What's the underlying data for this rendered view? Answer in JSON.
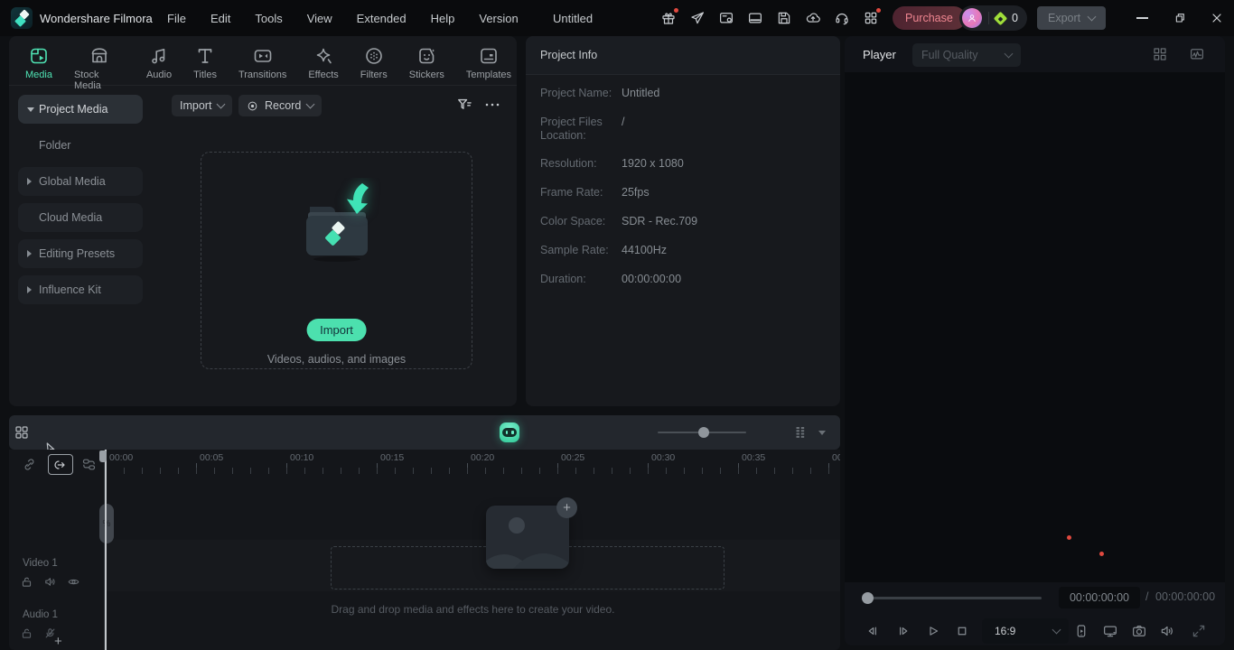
{
  "topbar": {
    "app_title": "Wondershare Filmora",
    "menus": [
      "File",
      "Edit",
      "Tools",
      "View",
      "Extended",
      "Help",
      "Version"
    ],
    "document_title": "Untitled",
    "purchase_label": "Purchase",
    "credit_count": "0",
    "export_label": "Export"
  },
  "media_panel": {
    "tabs": [
      "Media",
      "Stock Media",
      "Audio",
      "Titles",
      "Transitions",
      "Effects",
      "Filters",
      "Stickers",
      "Templates"
    ],
    "sidebar_items": [
      "Project Media",
      "Folder",
      "Global Media",
      "Cloud Media",
      "Editing Presets",
      "Influence Kit"
    ],
    "import_dropdown": "Import",
    "record_dropdown": "Record",
    "import_button": "Import",
    "import_hint": "Videos, audios, and images"
  },
  "project_info": {
    "title": "Project Info",
    "rows": [
      {
        "label": "Project Name:",
        "value": "Untitled"
      },
      {
        "label": "Project Files Location:",
        "value": "/"
      },
      {
        "label": "Resolution:",
        "value": "1920 x 1080"
      },
      {
        "label": "Frame Rate:",
        "value": "25fps"
      },
      {
        "label": "Color Space:",
        "value": "SDR - Rec.709"
      },
      {
        "label": "Sample Rate:",
        "value": "44100Hz"
      },
      {
        "label": "Duration:",
        "value": "00:00:00:00"
      }
    ]
  },
  "player": {
    "title": "Player",
    "quality": "Full Quality",
    "current_time": "00:00:00:00",
    "separator": "/",
    "total_time": "00:00:00:00",
    "aspect_ratio": "16:9"
  },
  "timeline": {
    "ruler_labels": [
      "00:00",
      "00:05",
      "00:10",
      "00:15",
      "00:20",
      "00:25",
      "00:30",
      "00:35",
      "00"
    ],
    "video_track_label": "Video 1",
    "audio_track_label": "Audio 1",
    "drop_hint": "Drag and drop media and effects here to create your video.",
    "add_track": "+"
  },
  "colors": {
    "accent_teal": "#4be0b0",
    "purchase_text": "#ee8590",
    "badge_red": "#e0493f"
  }
}
